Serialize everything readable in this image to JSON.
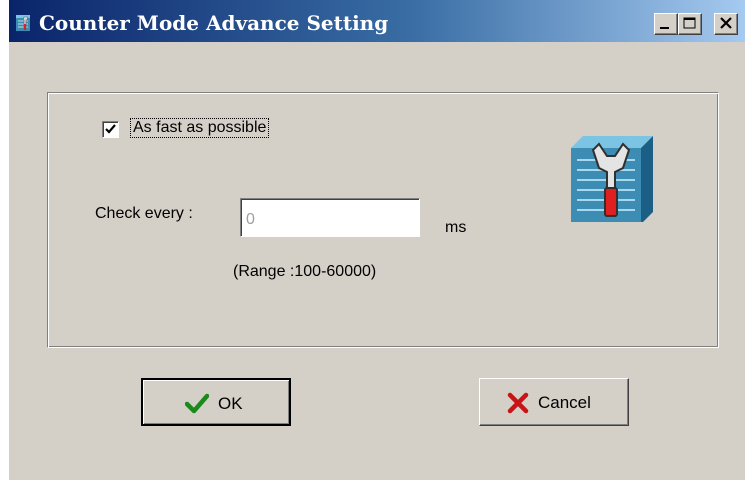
{
  "window": {
    "title": "Counter Mode Advance Setting",
    "controls": {
      "minimize": "_",
      "maximize": "□",
      "close": "X"
    },
    "title_icon": "app-tool-icon",
    "title_bar_colors": [
      "#0a246a",
      "#a6caf0"
    ]
  },
  "settings": {
    "checkbox": {
      "label": "As fast as possible",
      "checked": true
    },
    "check_every": {
      "label": "Check every :",
      "value": "0",
      "unit": "ms",
      "range_text": "(Range :100-60000)"
    },
    "decor_icon": "wrench-list-icon"
  },
  "buttons": {
    "ok": {
      "label": "OK",
      "icon": "checkmark-icon",
      "icon_color": "#1a8a1a"
    },
    "cancel": {
      "label": "Cancel",
      "icon": "cross-icon",
      "icon_color": "#c81414"
    }
  }
}
